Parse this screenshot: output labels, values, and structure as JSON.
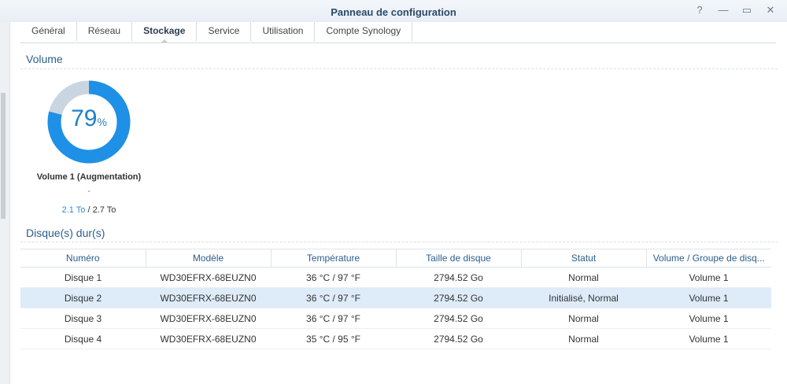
{
  "window": {
    "title": "Panneau de configuration"
  },
  "window_buttons": [
    {
      "name": "help-icon",
      "glyph": "?"
    },
    {
      "name": "minimize-icon",
      "glyph": "—"
    },
    {
      "name": "maximize-icon",
      "glyph": "▭"
    },
    {
      "name": "close-icon",
      "glyph": "✕"
    }
  ],
  "tabs": [
    {
      "label": "Général",
      "active": false
    },
    {
      "label": "Réseau",
      "active": false
    },
    {
      "label": "Stockage",
      "active": true
    },
    {
      "label": "Service",
      "active": false
    },
    {
      "label": "Utilisation",
      "active": false
    },
    {
      "label": "Compte Synology",
      "active": false
    }
  ],
  "volume": {
    "section_title": "Volume",
    "percent": "79",
    "percent_symbol": "%",
    "usage_fraction": 0.79,
    "name": "Volume 1 (Augmentation)",
    "sub": "-",
    "used": "2.1 To",
    "separator": " / ",
    "total": "2.7 To",
    "colors": {
      "used": "#1e90e6",
      "free": "#c9d5e0"
    }
  },
  "disks": {
    "section_title": "Disque(s) dur(s)",
    "columns": [
      "Numéro",
      "Modèle",
      "Température",
      "Taille de disque",
      "Statut",
      "Volume / Groupe de disq..."
    ],
    "rows": [
      {
        "numero": "Disque 1",
        "modele": "WD30EFRX-68EUZN0",
        "temperature": "36 °C / 97 °F",
        "taille": "2794.52 Go",
        "statut": "Normal",
        "volume": "Volume 1",
        "selected": false
      },
      {
        "numero": "Disque 2",
        "modele": "WD30EFRX-68EUZN0",
        "temperature": "36 °C / 97 °F",
        "taille": "2794.52 Go",
        "statut": "Initialisé, Normal",
        "volume": "Volume 1",
        "selected": true
      },
      {
        "numero": "Disque 3",
        "modele": "WD30EFRX-68EUZN0",
        "temperature": "36 °C / 97 °F",
        "taille": "2794.52 Go",
        "statut": "Normal",
        "volume": "Volume 1",
        "selected": false
      },
      {
        "numero": "Disque 4",
        "modele": "WD30EFRX-68EUZN0",
        "temperature": "35 °C / 95 °F",
        "taille": "2794.52 Go",
        "statut": "Normal",
        "volume": "Volume 1",
        "selected": false
      }
    ]
  }
}
